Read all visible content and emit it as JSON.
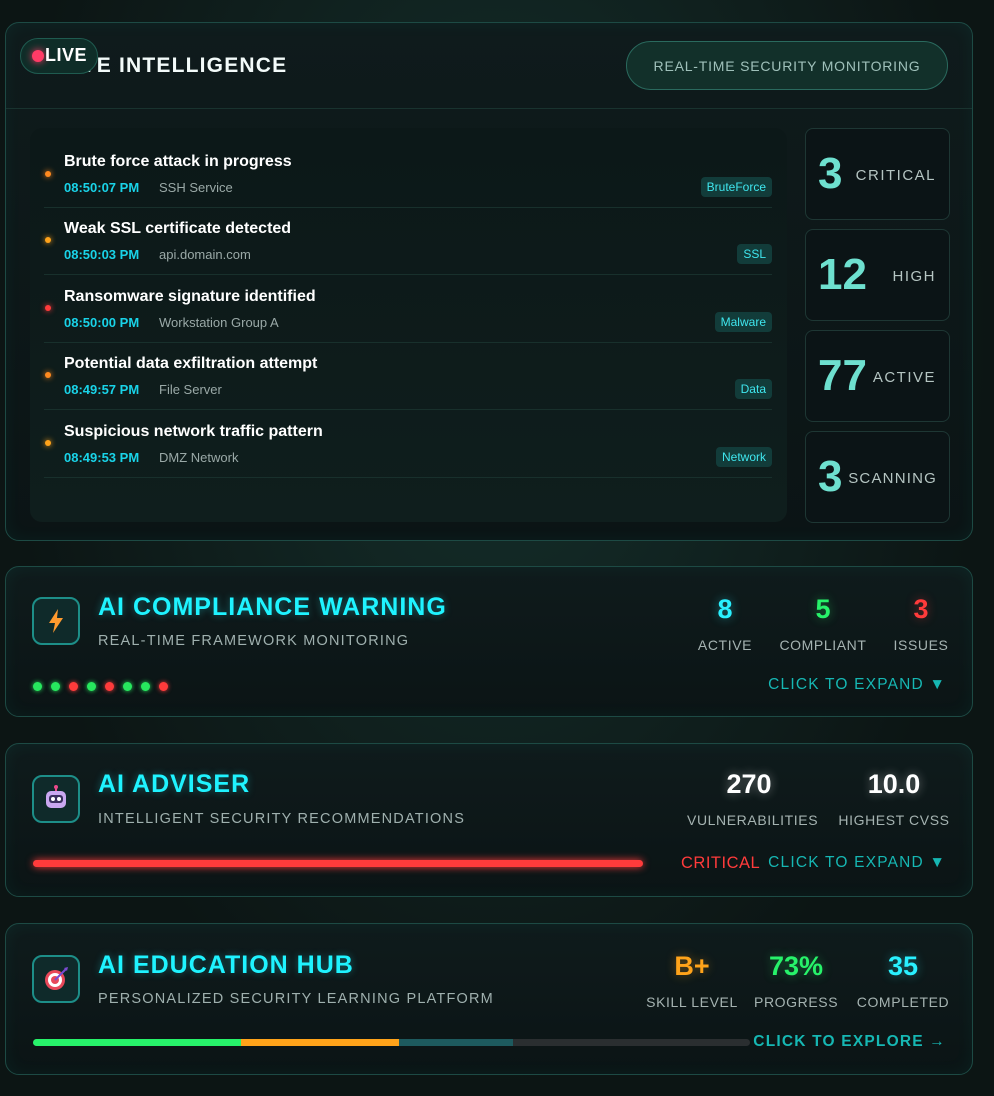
{
  "intel": {
    "live_label": "LIVE",
    "title": "AI LIVE INTELLIGENCE",
    "realtime_label": "REAL-TIME SECURITY MONITORING",
    "feed": [
      {
        "title": "Brute force attack in progress",
        "time": "08:50:07 PM",
        "source": "SSH Service",
        "tag": "BruteForce",
        "severity_color": "#ff8a1f"
      },
      {
        "title": "Weak SSL certificate detected",
        "time": "08:50:03 PM",
        "source": "api.domain.com",
        "tag": "SSL",
        "severity_color": "#ffa31a"
      },
      {
        "title": "Ransomware signature identified",
        "time": "08:50:00 PM",
        "source": "Workstation Group A",
        "tag": "Malware",
        "severity_color": "#ff3b3b"
      },
      {
        "title": "Potential data exfiltration attempt",
        "time": "08:49:57 PM",
        "source": "File Server",
        "tag": "Data",
        "severity_color": "#ff8a1f"
      },
      {
        "title": "Suspicious network traffic pattern",
        "time": "08:49:53 PM",
        "source": "DMZ Network",
        "tag": "Network",
        "severity_color": "#ffa31a"
      }
    ],
    "stats": [
      {
        "value": "3",
        "label": "CRITICAL"
      },
      {
        "value": "12",
        "label": "HIGH"
      },
      {
        "value": "77",
        "label": "ACTIVE"
      },
      {
        "value": "3",
        "label": "SCANNING"
      }
    ]
  },
  "compliance": {
    "title": "AI COMPLIANCE WARNING",
    "subtitle": "REAL-TIME FRAMEWORK MONITORING",
    "icon": "lightning-icon",
    "metrics": [
      {
        "value": "8",
        "label": "ACTIVE",
        "color": "#29f0ff"
      },
      {
        "value": "5",
        "label": "COMPLIANT",
        "color": "#27f26a"
      },
      {
        "value": "3",
        "label": "ISSUES",
        "color": "#ff3b3b"
      }
    ],
    "framework_dots": [
      "#27e85e",
      "#27e85e",
      "#ff3b3b",
      "#27e85e",
      "#ff3b3b",
      "#27e85e",
      "#27e85e",
      "#ff3b3b"
    ],
    "expand_label": "CLICK TO EXPAND ▼"
  },
  "adviser": {
    "title": "AI ADVISER",
    "subtitle": "INTELLIGENT SECURITY RECOMMENDATIONS",
    "icon": "robot-icon",
    "metrics": [
      {
        "value": "270",
        "label": "VULNERABILITIES",
        "color": "#ffffff"
      },
      {
        "value": "10.0",
        "label": "HIGHEST CVSS",
        "color": "#ffffff"
      }
    ],
    "severity_label": "CRITICAL",
    "severity_color": "#ff3b3b",
    "severity_fraction": 1.0,
    "expand_label": "CLICK TO EXPAND ▼"
  },
  "edu": {
    "title": "AI EDUCATION HUB",
    "subtitle": "PERSONALIZED SECURITY LEARNING PLATFORM",
    "icon": "target-icon",
    "metrics": [
      {
        "value": "B+",
        "label": "SKILL LEVEL",
        "color": "#ffa31a"
      },
      {
        "value": "73%",
        "label": "PROGRESS",
        "color": "#27f26a"
      },
      {
        "value": "35",
        "label": "COMPLETED",
        "color": "#29f0ff"
      }
    ],
    "progress_segments": [
      {
        "fraction": 0.29,
        "color": "#27f26a"
      },
      {
        "fraction": 0.22,
        "color": "#ffa31a"
      },
      {
        "fraction": 0.16,
        "color": "#1d5a5e"
      }
    ],
    "expand_label": "CLICK TO EXPLORE →"
  }
}
